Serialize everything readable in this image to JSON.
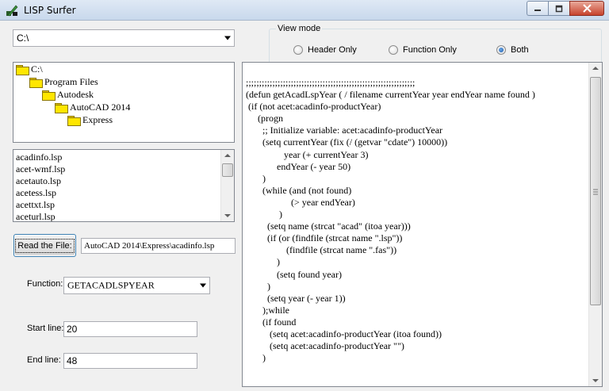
{
  "window": {
    "title": "LISP Surfer"
  },
  "drive_combo": {
    "value": "C:\\"
  },
  "view_mode": {
    "label": "View mode",
    "options": [
      {
        "label": "Header Only",
        "checked": false
      },
      {
        "label": "Function Only",
        "checked": false
      },
      {
        "label": "Both",
        "checked": true
      }
    ]
  },
  "tree": {
    "items": [
      {
        "label": "C:\\"
      },
      {
        "label": "Program Files"
      },
      {
        "label": "Autodesk"
      },
      {
        "label": "AutoCAD 2014"
      },
      {
        "label": "Express"
      }
    ]
  },
  "files": {
    "items": [
      "acadinfo.lsp",
      "acet-wmf.lsp",
      "acetauto.lsp",
      "acetess.lsp",
      "acettxt.lsp",
      "aceturl.lsp"
    ]
  },
  "read_button": {
    "label": "Read the File:"
  },
  "file_path": {
    "value": "AutoCAD 2014\\Express\\acadinfo.lsp"
  },
  "function": {
    "label": "Function:",
    "value": "GETACADLSPYEAR"
  },
  "start_line": {
    "label": "Start line:",
    "value": "20"
  },
  "end_line": {
    "label": "End line:",
    "value": "48"
  },
  "code": {
    "text": ";;;;;;;;;;;;;;;;;;;;;;;;;;;;;;;;;;;;;;;;;;;;;;;;;;;;;;;;;;;;;;;;\n(defun getAcadLspYear ( / filename currentYear year endYear name found )\n (if (not acet:acadinfo-productYear)\n     (progn\n       ;; Initialize variable: acet:acadinfo-productYear\n       (setq currentYear (fix (/ (getvar \"cdate\") 10000))\n                year (+ currentYear 3)\n             endYear (- year 50)\n       )\n       (while (and (not found)\n                   (> year endYear)\n              )\n         (setq name (strcat \"acad\" (itoa year)))\n         (if (or (findfile (strcat name \".lsp\"))\n                 (findfile (strcat name \".fas\"))\n             )\n             (setq found year)\n         )\n         (setq year (- year 1))\n       );while\n       (if found\n          (setq acet:acadinfo-productYear (itoa found))\n          (setq acet:acadinfo-productYear \"\")\n       )"
  }
}
